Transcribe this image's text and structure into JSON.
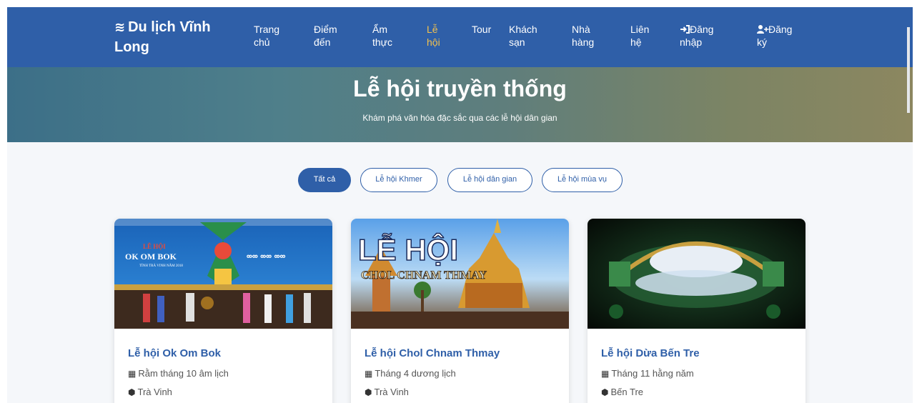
{
  "navbar": {
    "brand_icon": "waves-icon",
    "brand": "Du lịch Vĩnh Long",
    "items": [
      {
        "label": "Trang chủ"
      },
      {
        "label": "Điểm đến"
      },
      {
        "label": "Ẩm thực"
      },
      {
        "label": "Lễ hội",
        "active": true
      },
      {
        "label": "Tour"
      },
      {
        "label": "Khách sạn"
      },
      {
        "label": "Nhà hàng"
      },
      {
        "label": "Liên hệ"
      },
      {
        "label": "Đăng nhập",
        "icon": "sign-in-icon"
      },
      {
        "label": "Đăng ký",
        "icon": "user-plus-icon"
      }
    ]
  },
  "hero": {
    "title": "Lễ hội truyền thống",
    "subtitle": "Khám phá văn hóa đặc sắc qua các lễ hội dân gian"
  },
  "filters": [
    {
      "label": "Tất cả",
      "active": true
    },
    {
      "label": "Lễ hội Khmer"
    },
    {
      "label": "Lễ hội dân gian"
    },
    {
      "label": "Lễ hội mùa vụ"
    }
  ],
  "cards": [
    {
      "image_text": [
        "LỄ HỘI",
        "OK OM BOK",
        "TỈNH TRÀ VINH NĂM 2018"
      ],
      "title": "Lễ hội Ok Om Bok",
      "date": "Rằm tháng 10 âm lịch",
      "location": "Trà Vinh"
    },
    {
      "image_text": [
        "LỄ HỘI",
        "CHOL CHNAM THMAY"
      ],
      "title": "Lễ hội Chol Chnam Thmay",
      "date": "Tháng 4 dương lịch",
      "location": "Trà Vinh"
    },
    {
      "image_text": [],
      "title": "Lễ hội Dừa Bến Tre",
      "date": "Tháng 11 hằng năm",
      "location": "Bến Tre"
    }
  ],
  "colors": {
    "primary": "#2f5fa8",
    "active_nav": "#f2c14e"
  }
}
